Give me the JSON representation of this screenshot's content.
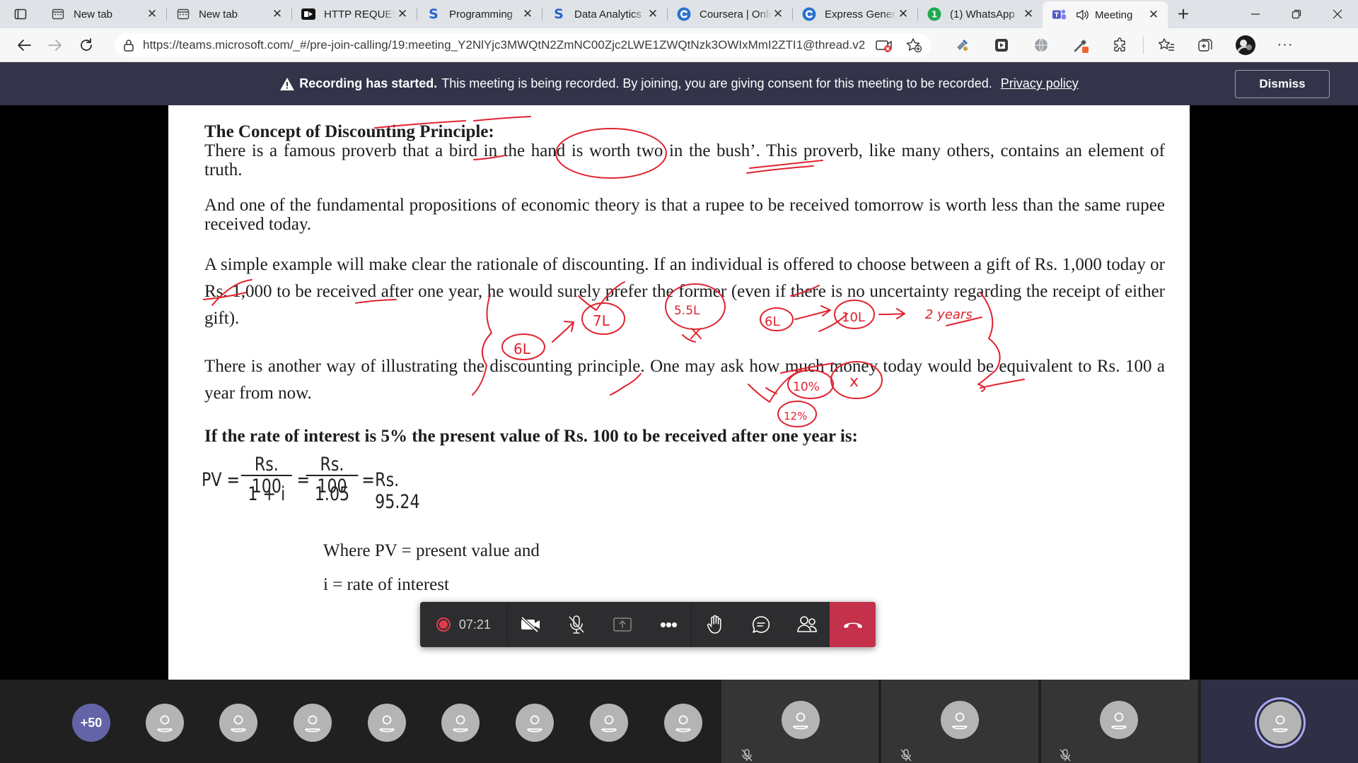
{
  "browser": {
    "tabs": [
      {
        "title": "New tab",
        "icon": "newtab-icon",
        "active": false
      },
      {
        "title": "New tab",
        "icon": "newtab-icon",
        "active": false
      },
      {
        "title": "HTTP REQUESTS",
        "icon": "video-site-icon",
        "active": false
      },
      {
        "title": "Programming",
        "icon": "s-brand-icon",
        "active": false
      },
      {
        "title": "Data Analytics",
        "icon": "s-brand-icon",
        "active": false
      },
      {
        "title": "Coursera | Online",
        "icon": "coursera-icon",
        "active": false
      },
      {
        "title": "Express General",
        "icon": "coursera-icon",
        "active": false
      },
      {
        "title": "(1) WhatsApp",
        "icon": "whatsapp-icon",
        "active": false
      },
      {
        "title": "Meeting",
        "icon": "teams-icon",
        "active": true
      }
    ],
    "url": "https://teams.microsoft.com/_#/pre-join-calling/19:meeting_Y2NlYjc3MWQtN2ZmNC00Zjc2LWE1ZWQtNzk3OWIxMmI2ZTI1@thread.v2"
  },
  "banner": {
    "bold": "Recording has started.",
    "text": "This meeting is being recorded. By joining, you are giving consent for this meeting to be recorded.",
    "link": "Privacy policy",
    "dismiss": "Dismiss"
  },
  "document": {
    "heading": "The Concept of Discounting Principle:",
    "para1": "There is a famous proverb that a bird in the hand is worth two in the bush’. This proverb, like many others, contains an element of truth.",
    "para2": "And one of the fundamental propositions of economic theory is that a rupee to be received tomorrow is worth less than the same rupee received today.",
    "para3": "A simple example will make clear the rationale of discounting. If an individual is offered to choose between a gift of Rs. 1,000 today or Rs. 1,000 to be received after one year, he would surely prefer the former (even if there is no uncertainty regarding the receipt of either gift).",
    "para4": "There is another way of illustrating the discounting principle. One may ask how much money today would be equivalent to Rs. 100 a year from now.",
    "bold_line": "If the rate of interest is 5% the present value of Rs. 100 to be received after one year is:",
    "formula": {
      "lhs": "PV =",
      "num1": "Rs. 100",
      "den1": "1 + i",
      "eq2": "=",
      "num2": "Rs. 100",
      "den2": "1.05",
      "eq3": "=",
      "result": "Rs. 95.24"
    },
    "where1": "Where PV = present value and",
    "where2": "i = rate of interest",
    "annotations": [
      "6L",
      "7L",
      "5.5L",
      "6L",
      "10L",
      "2 years",
      "10%",
      "x",
      "12%"
    ]
  },
  "call": {
    "timer": "07:21",
    "more_participants": "+50"
  }
}
